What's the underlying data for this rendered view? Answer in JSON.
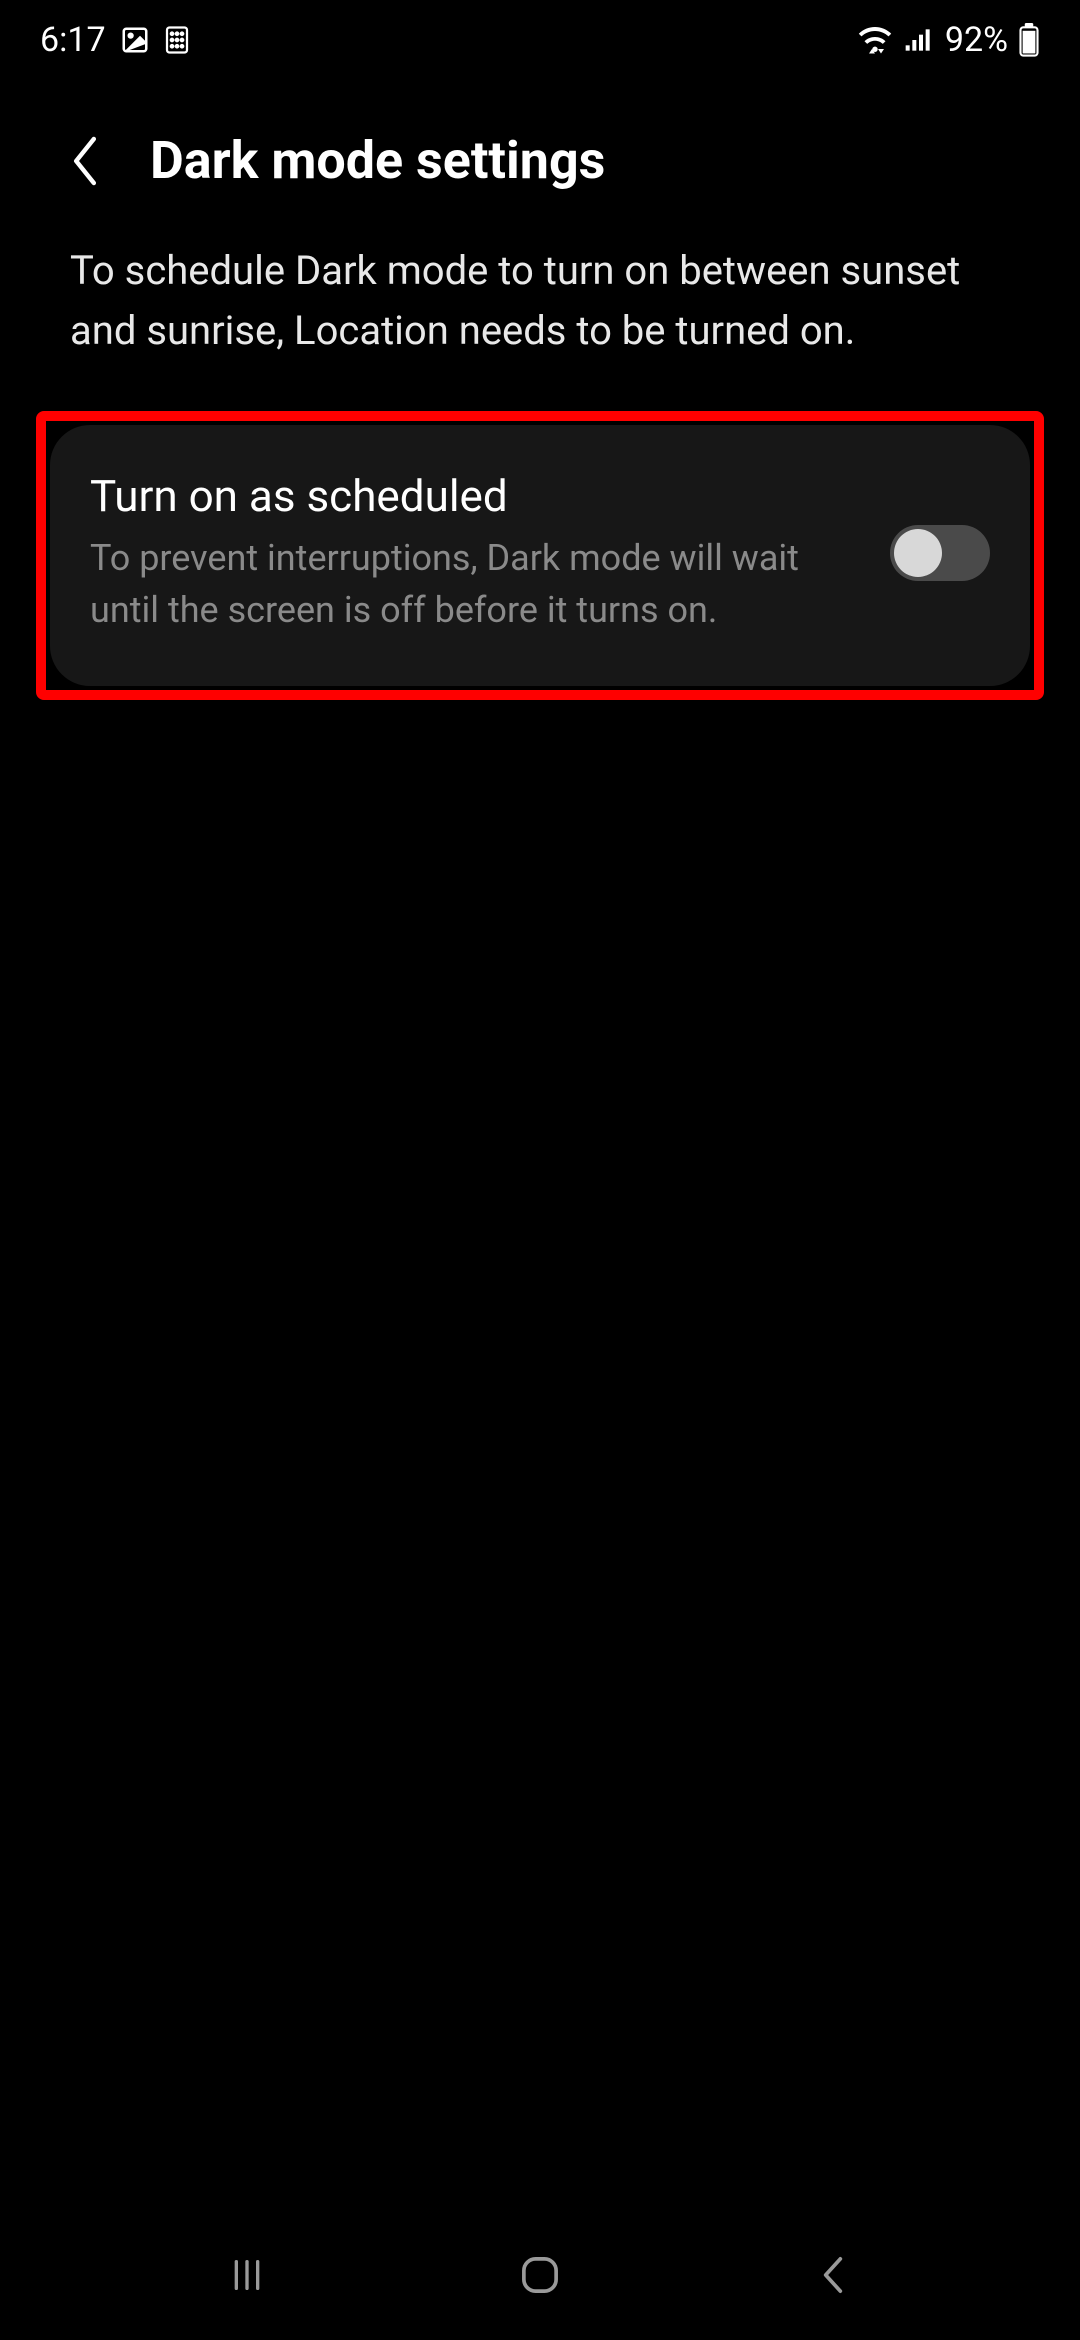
{
  "status_bar": {
    "time": "6:17",
    "battery_percent": "92%"
  },
  "header": {
    "title": "Dark mode settings"
  },
  "description": "To schedule Dark mode to turn on between sunset and sunrise, Location needs to be turned on.",
  "card": {
    "title": "Turn on as scheduled",
    "subtitle": "To prevent interruptions, Dark mode will wait until the screen is off before it turns on.",
    "toggle_on": false
  }
}
